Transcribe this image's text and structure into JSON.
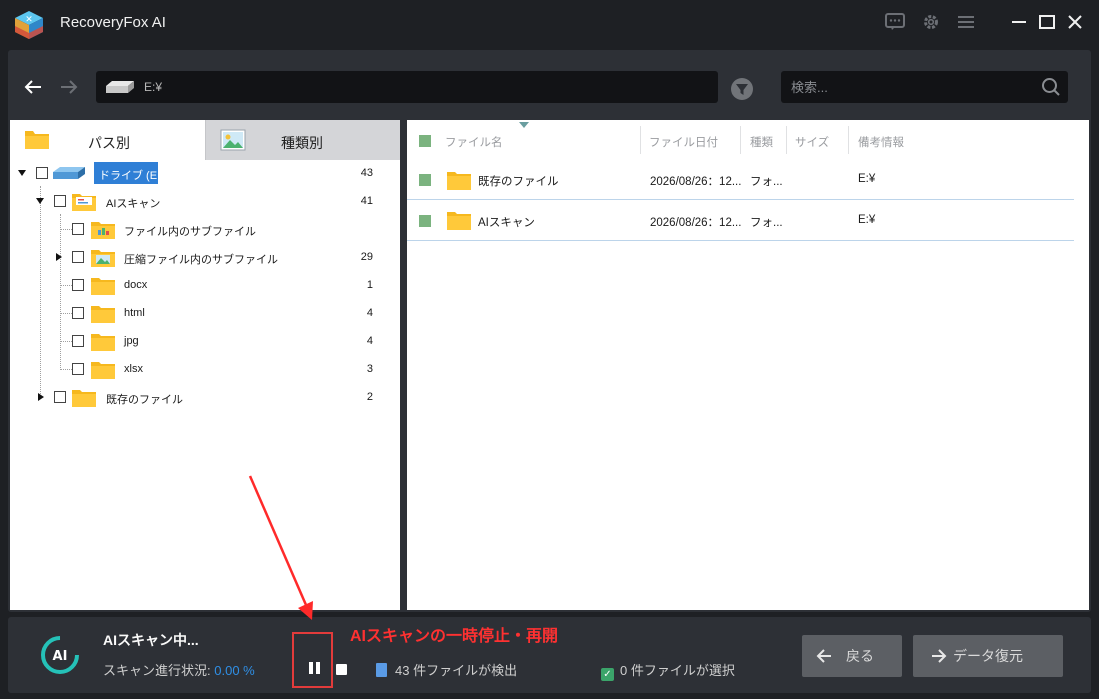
{
  "app": {
    "title": "RecoveryFox AI"
  },
  "toolbar": {
    "path": "E:¥",
    "search_placeholder": "検索..."
  },
  "left_tabs": [
    {
      "label": "パス別",
      "active": true
    },
    {
      "label": "種類別",
      "active": false
    }
  ],
  "tree": [
    {
      "label": "ドライブ (E:)",
      "count": "43",
      "expander": "down",
      "selected": true
    },
    {
      "label": "AIスキャン",
      "count": "41",
      "expander": "down"
    },
    {
      "label": "ファイル内のサブファイル",
      "count": ""
    },
    {
      "label": "圧縮ファイル内のサブファイル",
      "count": "29",
      "expander": "right"
    },
    {
      "label": "docx",
      "count": "1"
    },
    {
      "label": "html",
      "count": "4"
    },
    {
      "label": "jpg",
      "count": "4"
    },
    {
      "label": "xlsx",
      "count": "3"
    },
    {
      "label": "既存のファイル",
      "count": "2",
      "expander": "right"
    }
  ],
  "columns": [
    "ファイル名",
    "ファイル日付",
    "種類",
    "サイズ",
    "備考情報"
  ],
  "files": [
    {
      "name": "既存のファイル",
      "date": "2026/08/26：12...",
      "type": "フォ...",
      "size": "",
      "note": "E:¥"
    },
    {
      "name": "AIスキャン",
      "date": "2026/08/26：12...",
      "type": "フォ...",
      "size": "",
      "note": "E:¥"
    }
  ],
  "status": {
    "title": "AIスキャン中...",
    "progress_label": "スキャン進行状況:",
    "progress_value": "0.00 %",
    "found": "43 件ファイルが検出",
    "selected": "0 件ファイルが選択"
  },
  "annotation": "AIスキャンの一時停止・再開",
  "buttons": {
    "back": "戻る",
    "restore": "データ復元"
  },
  "colors": {
    "accent": "#2f8fe6",
    "annotation": "#ff3131",
    "selection": "#2f7fd6",
    "check": "#7bb37f"
  }
}
